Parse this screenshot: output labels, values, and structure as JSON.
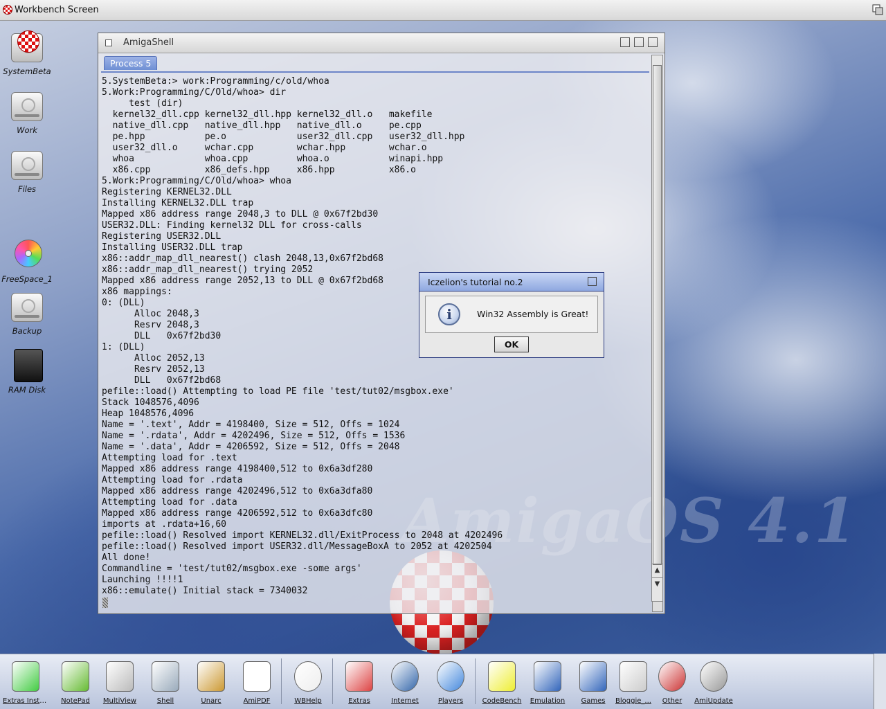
{
  "screen": {
    "title": "Workbench Screen"
  },
  "desktop_icons": [
    {
      "label": "SystemBeta",
      "icon": "boing-disk-icon"
    },
    {
      "label": "Work",
      "icon": "harddisk-icon"
    },
    {
      "label": "Files",
      "icon": "harddisk-icon"
    },
    {
      "label": "FreeSpace_1",
      "icon": "cdrom-icon"
    },
    {
      "label": "Backup",
      "icon": "harddisk-icon"
    },
    {
      "label": "RAM Disk",
      "icon": "ramdisk-icon"
    }
  ],
  "shell": {
    "title": "AmigaShell",
    "tab": "Process 5",
    "console_lines": [
      "5.SystemBeta:> work:Programming/c/old/whoa",
      "5.Work:Programming/C/Old/whoa> dir",
      "     test (dir)",
      "  kernel32_dll.cpp kernel32_dll.hpp kernel32_dll.o   makefile",
      "  native_dll.cpp   native_dll.hpp   native_dll.o     pe.cpp",
      "  pe.hpp           pe.o             user32_dll.cpp   user32_dll.hpp",
      "  user32_dll.o     wchar.cpp        wchar.hpp        wchar.o",
      "  whoa             whoa.cpp         whoa.o           winapi.hpp",
      "  x86.cpp          x86_defs.hpp     x86.hpp          x86.o",
      "5.Work:Programming/C/Old/whoa> whoa",
      "Registering KERNEL32.DLL",
      "Installing KERNEL32.DLL trap",
      "Mapped x86 address range 2048,3 to DLL @ 0x67f2bd30",
      "USER32.DLL: Finding kernel32 DLL for cross-calls",
      "Registering USER32.DLL",
      "Installing USER32.DLL trap",
      "x86::addr_map_dll_nearest() clash 2048,13,0x67f2bd68",
      "x86::addr_map_dll_nearest() trying 2052",
      "Mapped x86 address range 2052,13 to DLL @ 0x67f2bd68",
      "x86 mappings:",
      "0: (DLL)",
      "      Alloc 2048,3",
      "      Resrv 2048,3",
      "      DLL   0x67f2bd30",
      "1: (DLL)",
      "      Alloc 2052,13",
      "      Resrv 2052,13",
      "      DLL   0x67f2bd68",
      "pefile::load() Attempting to load PE file 'test/tut02/msgbox.exe'",
      "Stack 1048576,4096",
      "Heap 1048576,4096",
      "Name = '.text', Addr = 4198400, Size = 512, Offs = 1024",
      "Name = '.rdata', Addr = 4202496, Size = 512, Offs = 1536",
      "Name = '.data', Addr = 4206592, Size = 512, Offs = 2048",
      "Attempting load for .text",
      "Mapped x86 address range 4198400,512 to 0x6a3df280",
      "Attempting load for .rdata",
      "Mapped x86 address range 4202496,512 to 0x6a3dfa80",
      "Attempting load for .data",
      "Mapped x86 address range 4206592,512 to 0x6a3dfc80",
      "imports at .rdata+16,60",
      "pefile::load() Resolved import KERNEL32.dll/ExitProcess to 2048 at 4202496",
      "pefile::load() Resolved import USER32.dll/MessageBoxA to 2052 at 4202504",
      "All done!",
      "Commandline = 'test/tut02/msgbox.exe -some args'",
      "Launching !!!!1",
      "x86::emulate() Initial stack = 7340032"
    ]
  },
  "dialog": {
    "title": "Iczelion's tutorial no.2",
    "message": "Win32 Assembly is Great!",
    "ok_label": "OK",
    "icon": "info-icon"
  },
  "background": {
    "logo_text": "AmigaOS 4.1"
  },
  "dock": {
    "items": [
      {
        "label": "Extras Instal...",
        "icon": "installer-icon"
      },
      {
        "label": "NotePad",
        "icon": "notepad-icon"
      },
      {
        "label": "MultiView",
        "icon": "magnifier-icon"
      },
      {
        "label": "Shell",
        "icon": "shell-icon"
      },
      {
        "label": "Unarc",
        "icon": "archive-box-icon"
      },
      {
        "label": "AmiPDF",
        "icon": "pdf-icon"
      },
      {
        "label": "WBHelp",
        "icon": "lightbulb-icon"
      },
      {
        "label": "Extras",
        "icon": "extras-drawer-icon"
      },
      {
        "label": "Internet",
        "icon": "globe-icon"
      },
      {
        "label": "Players",
        "icon": "play-icon"
      },
      {
        "label": "CodeBench",
        "icon": "codebench-icon"
      },
      {
        "label": "Emulation",
        "icon": "drawer-icon"
      },
      {
        "label": "Games",
        "icon": "drawer-icon"
      },
      {
        "label": "Bloggie_...",
        "icon": "ascii-search-icon"
      },
      {
        "label": "Other",
        "icon": "eject-icon"
      },
      {
        "label": "AmiUpdate",
        "icon": "gear-icon"
      }
    ]
  }
}
